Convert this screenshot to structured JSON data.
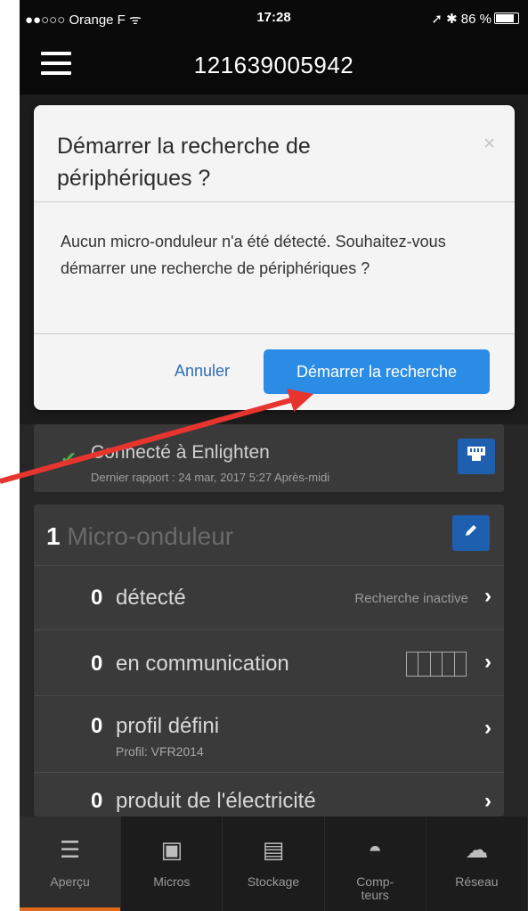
{
  "status_bar": {
    "carrier": "●●○○○ Orange F ᯤ",
    "time": "17:28",
    "right": "➚ ✱ 86 %"
  },
  "header": {
    "title": "121639005942"
  },
  "dialog": {
    "title": "Démarrer la recherche de périphériques ?",
    "close": "×",
    "body": "Aucun micro-onduleur n'a été détecté. Souhaitez-vous démarrer une recherche de périphériques ?",
    "cancel_label": "Annuler",
    "confirm_label": "Démarrer la recherche"
  },
  "connection": {
    "label": "Connecté à Enlighten",
    "sub": "Dernier rapport : 24 mar, 2017 5:27 Après-midi",
    "check": "✔",
    "icon": "ethernet-icon"
  },
  "micro": {
    "count": "1",
    "title": "Micro-onduleur",
    "rows": [
      {
        "num": "0",
        "label": "détecté",
        "status": "Recherche inactive",
        "sub": ""
      },
      {
        "num": "0",
        "label": "en communication",
        "status": "",
        "sub": ""
      },
      {
        "num": "0",
        "label": "profil défini",
        "status": "",
        "sub": "Profil: VFR2014"
      },
      {
        "num": "0",
        "label": "produit de l'électricité",
        "status": "",
        "sub": ""
      }
    ],
    "chevron": "›"
  },
  "tabs": [
    {
      "label": "Aperçu",
      "icon": "list-icon",
      "glyph": "☰"
    },
    {
      "label": "Micros",
      "icon": "micro-icon",
      "glyph": "▣"
    },
    {
      "label": "Stockage",
      "icon": "battery-icon",
      "glyph": "▤"
    },
    {
      "label": "Comp-teurs",
      "icon": "meter-icon",
      "glyph": "◓"
    },
    {
      "label": "Réseau",
      "icon": "cloud-upload-icon",
      "glyph": "☁"
    }
  ],
  "colors": {
    "accent": "#2b8ce6",
    "active_tab": "#e06a1a",
    "check": "#4caf50"
  }
}
